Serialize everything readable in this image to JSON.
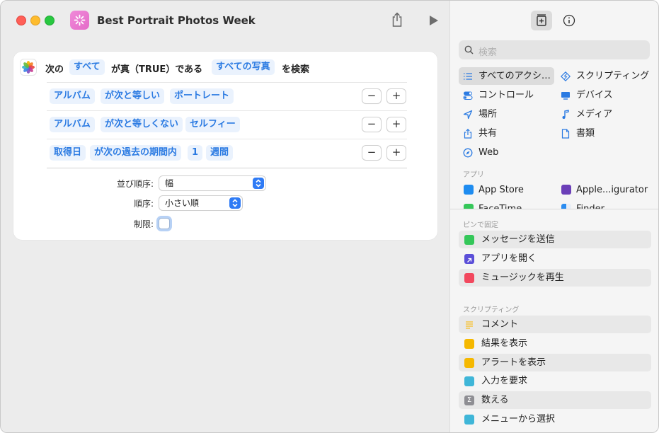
{
  "window": {
    "title": "Best Portrait Photos Week"
  },
  "filter": {
    "prefix": "次の",
    "match_mode": "すべて",
    "middle": "が真（TRUE）である",
    "source": "すべての写真",
    "suffix": "を検索"
  },
  "conditions": [
    {
      "field": "アルバム",
      "op": "が次と等しい",
      "value": "ポートレート"
    },
    {
      "field": "アルバム",
      "op": "が次と等しくない",
      "value": "セルフィー"
    },
    {
      "field": "取得日",
      "op": "が次の過去の期間内",
      "value": "1",
      "unit": "週間"
    }
  ],
  "sort": {
    "sort_label": "並び順序:",
    "sort_value": "幅",
    "order_label": "順序:",
    "order_value": "小さい順",
    "limit_label": "制限:"
  },
  "buttons": {
    "minus": "−",
    "plus": "+"
  },
  "sidebar": {
    "search_placeholder": "検索",
    "categories_left": [
      "すべてのアクシ…",
      "コントロール",
      "場所",
      "共有",
      "Web"
    ],
    "categories_right": [
      "スクリプティング",
      "デバイス",
      "メディア",
      "書類"
    ],
    "apps_header": "アプリ",
    "apps": [
      "App Store",
      "Apple...igurator",
      "FaceTime",
      "Finder"
    ],
    "pinned_header": "ピンで固定",
    "pinned": [
      "メッセージを送信",
      "アプリを開く",
      "ミュージックを再生"
    ],
    "scripting_header": "スクリプティング",
    "scripting": [
      "コメント",
      "結果を表示",
      "アラートを表示",
      "入力を要求",
      "数える",
      "メニューから選択"
    ]
  },
  "colors": {
    "accent": "#2a7ae2",
    "pill_bg": "#eaf2fd"
  }
}
